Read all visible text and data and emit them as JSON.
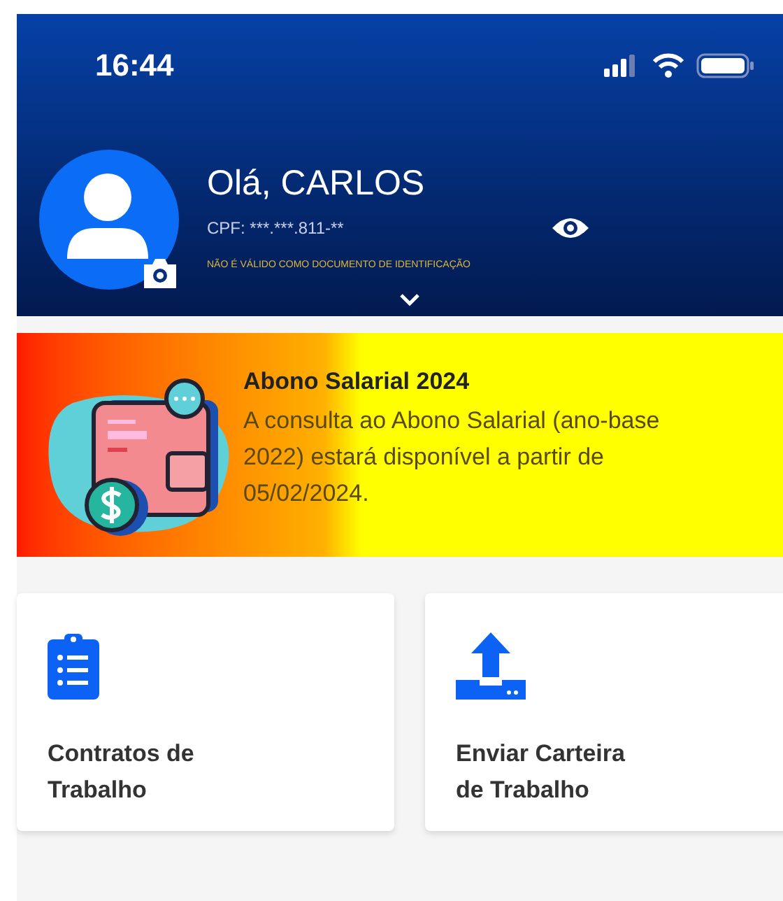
{
  "status_bar": {
    "time": "16:44"
  },
  "profile": {
    "greeting": "Olá, CARLOS",
    "cpf": "CPF: ***.***.811-**",
    "notice": "NÃO É VÁLIDO COMO DOCUMENTO DE IDENTIFICAÇÃO"
  },
  "banner": {
    "title": "Abono Salarial 2024",
    "text": "A consulta ao Abono Salarial (ano-base 2022) estará disponível a partir de 05/02/2024."
  },
  "cards": [
    {
      "kind": "clipboard",
      "label": "Contratos de Trabalho"
    },
    {
      "kind": "upload",
      "label": "Enviar Carteira de Trabalho"
    }
  ]
}
